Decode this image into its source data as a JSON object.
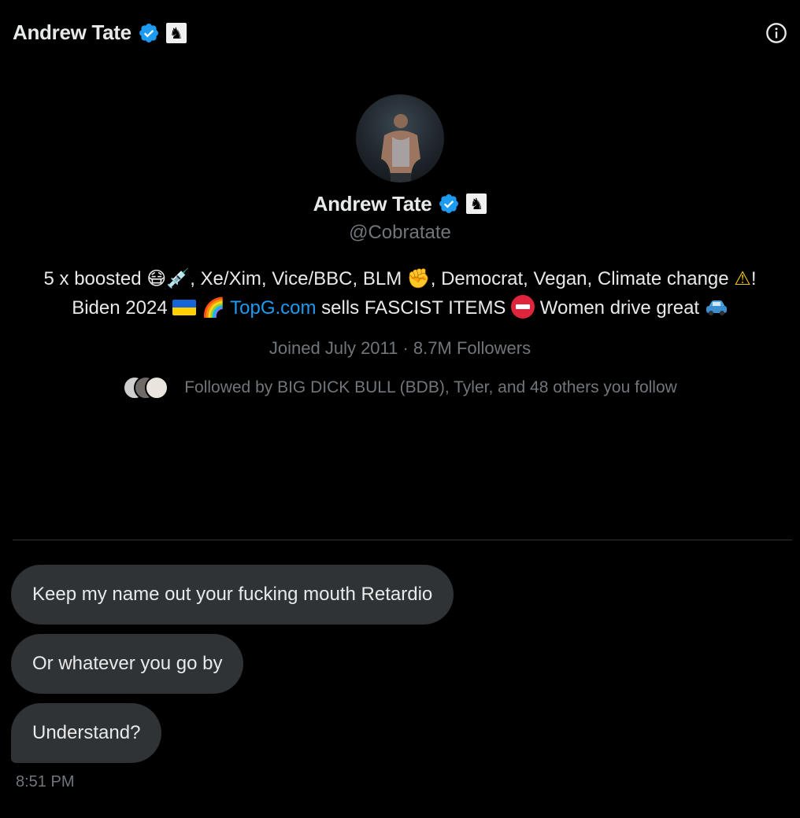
{
  "header": {
    "title": "Andrew Tate",
    "verified_icon": "verified-badge-icon",
    "affiliate_icon": "chess-knight-icon",
    "info_icon": "info-icon"
  },
  "profile": {
    "name": "Andrew Tate",
    "handle": "@Cobratate",
    "bio": {
      "line1_a": "5 x boosted ",
      "emoji_mask": "😷",
      "emoji_syringe": "💉",
      "line1_b": ", Xe/Xim, Vice/BBC, BLM ",
      "emoji_fist": "✊",
      "line1_c": ", Democrat, Vegan, Climate change ",
      "emoji_warning": "⚠",
      "line2_a": "! Biden 2024 ",
      "emoji_rainbow": "🌈",
      "link": "TopG.com",
      "line2_b": " sells FASCIST ITEMS ",
      "line2_c": " Women drive great "
    },
    "joined": "Joined July 2011 · 8.7M Followers",
    "followed_by": "Followed by BIG DICK BULL (BDB), Tyler, and 48 others you follow"
  },
  "messages": [
    {
      "text": "Keep my name out your fucking mouth Retardio"
    },
    {
      "text": "Or whatever you go by"
    },
    {
      "text": "Understand?"
    }
  ],
  "timestamp": "8:51 PM",
  "colors": {
    "background": "#000000",
    "text_primary": "#e7e9ea",
    "text_secondary": "#71767b",
    "link": "#1d9bf0",
    "verified": "#1d9bf0",
    "bubble": "#2f3336",
    "divider": "#2f3336"
  }
}
